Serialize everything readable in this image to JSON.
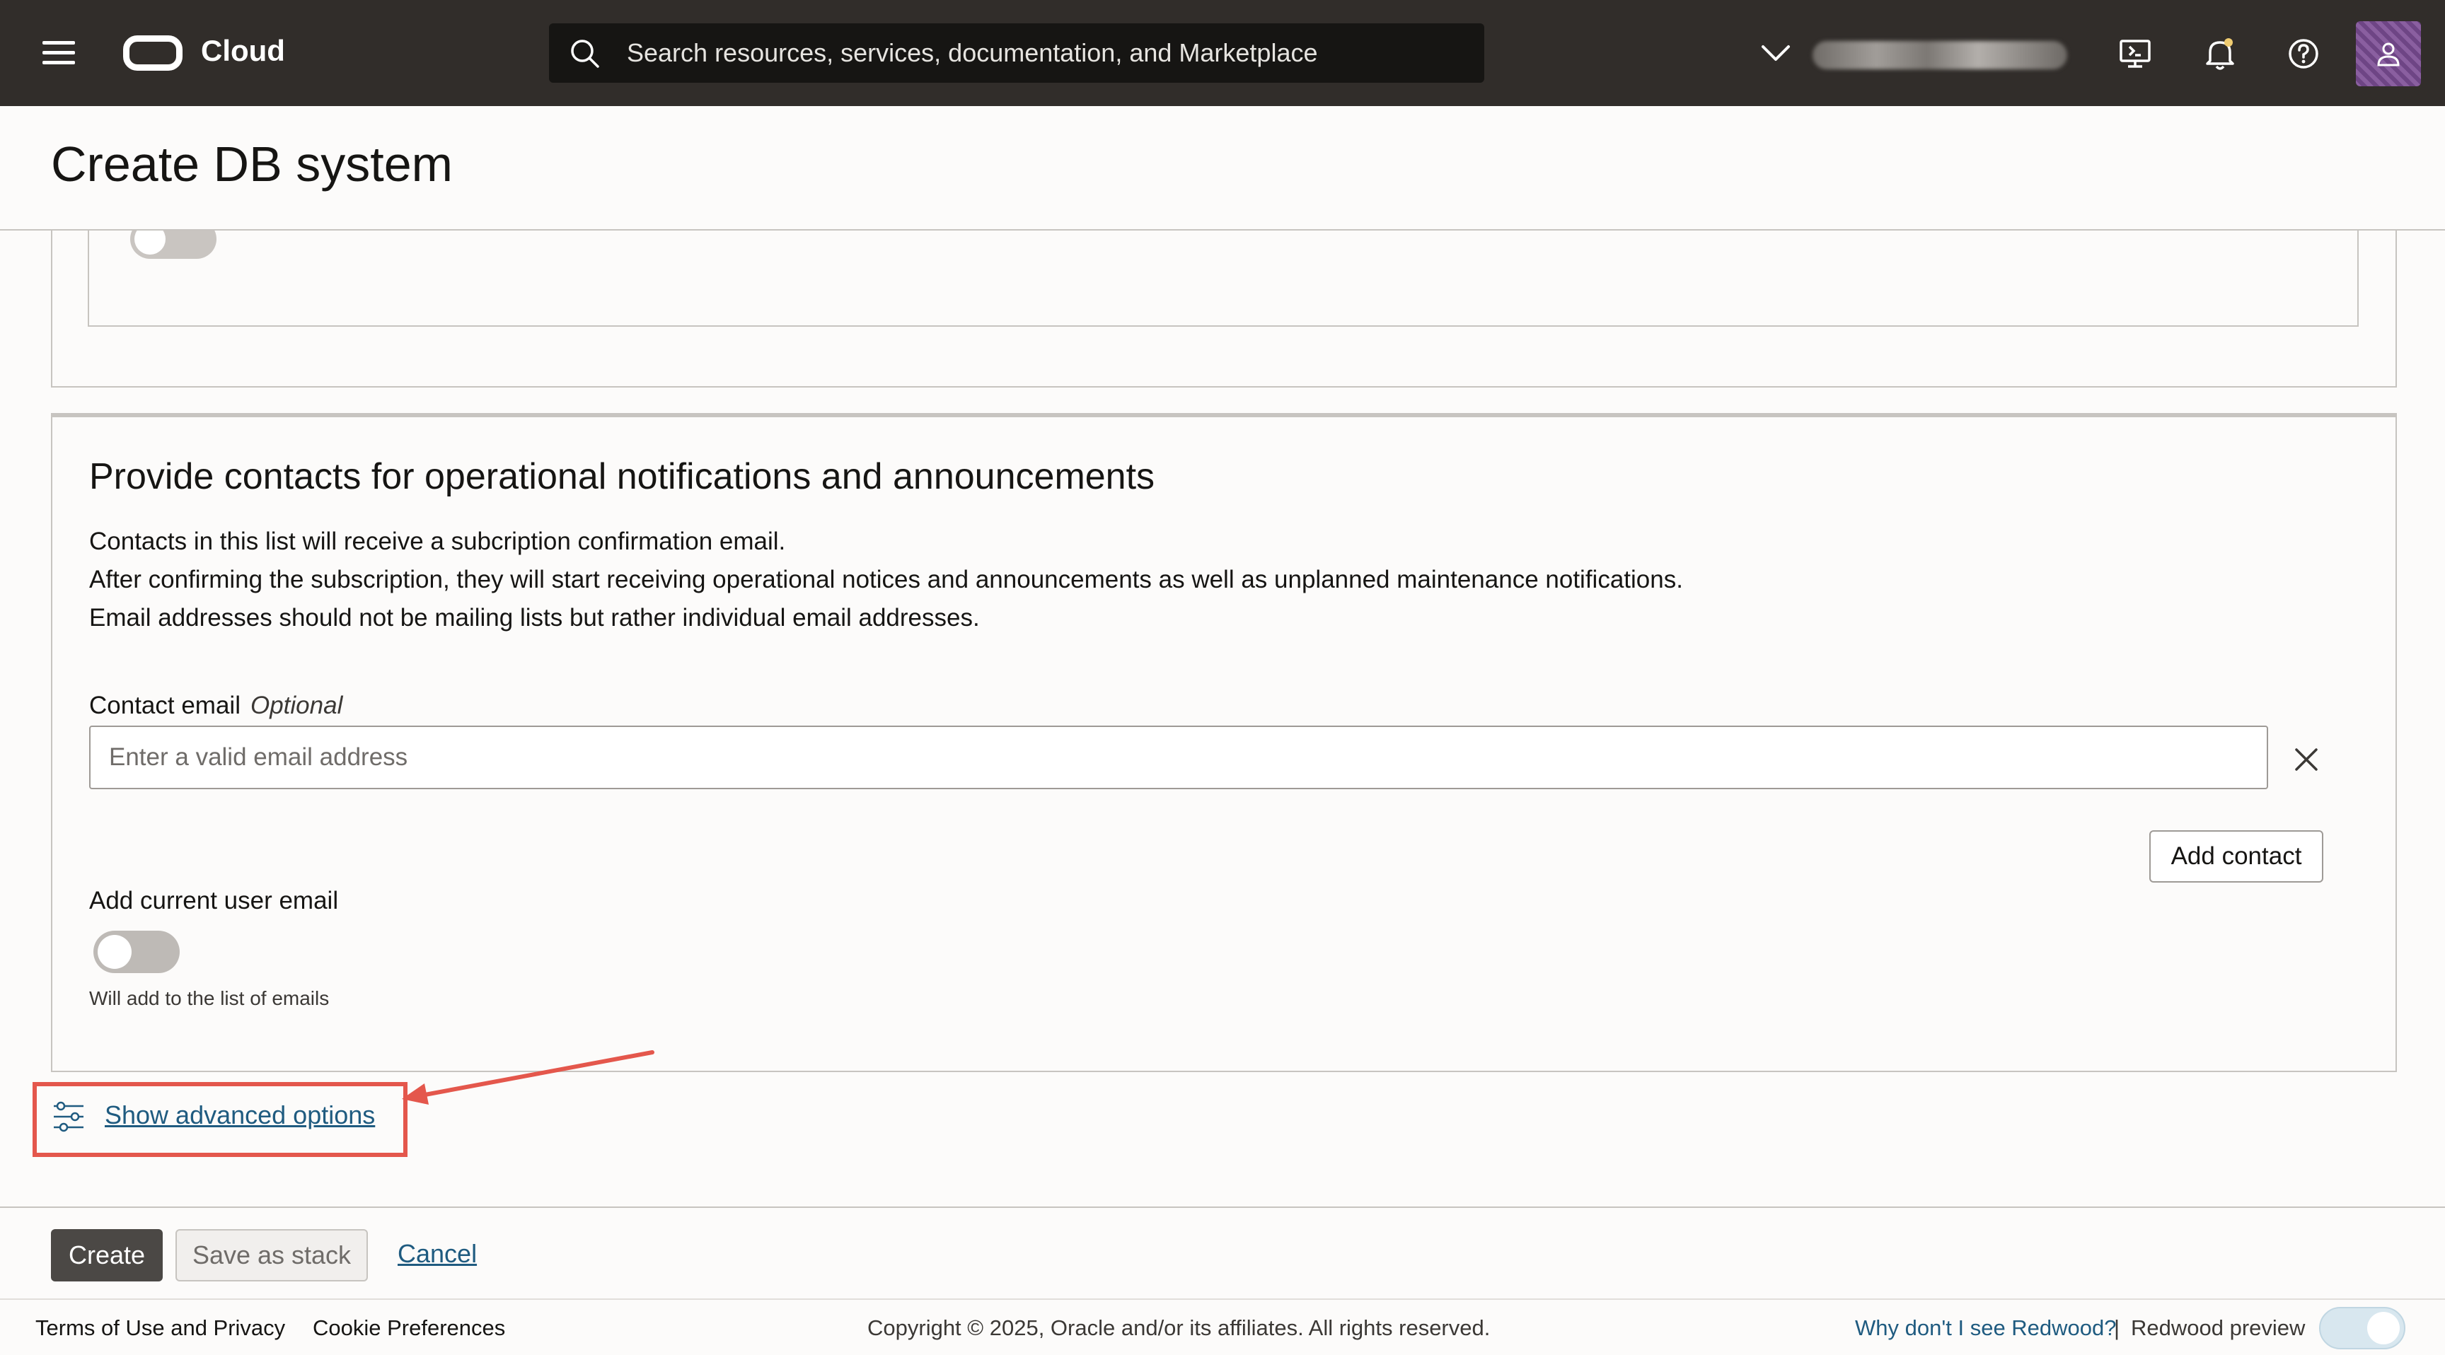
{
  "header": {
    "brand": "Cloud",
    "search_placeholder": "Search resources, services, documentation, and Marketplace",
    "region": "",
    "icons": [
      "menu-icon",
      "oracle-logo",
      "search-icon",
      "chevron-down-icon",
      "cloud-shell-icon",
      "bell-icon",
      "help-icon",
      "profile-icon"
    ]
  },
  "page": {
    "title": "Create DB system"
  },
  "contacts_section": {
    "title": "Provide contacts for operational notifications and announcements",
    "description": [
      "Contacts in this list will receive a subcription confirmation email.",
      "After confirming the subscription, they will start receiving operational notices and announcements as well as unplanned maintenance notifications.",
      "Email addresses should not be mailing lists but rather individual email addresses."
    ],
    "email_label": "Contact email",
    "email_optional": "Optional",
    "email_placeholder": "Enter a valid email address",
    "email_value": "",
    "add_contact_label": "Add contact",
    "current_user_label": "Add current user email",
    "current_user_enabled": false,
    "current_user_helper": "Will add to the list of emails"
  },
  "advanced": {
    "link_label": "Show advanced options"
  },
  "actions": {
    "create_label": "Create",
    "save_stack_label": "Save as stack",
    "cancel_label": "Cancel"
  },
  "footer": {
    "terms": "Terms of Use and Privacy",
    "cookies": "Cookie Preferences",
    "copyright": "Copyright © 2025, Oracle and/or its affiliates. All rights reserved.",
    "why_redwood": "Why don't I see Redwood?",
    "separator": "|",
    "redwood_preview": "Redwood preview",
    "redwood_preview_enabled": true
  },
  "colors": {
    "topbar": "#312d2a",
    "link": "#1f5b80",
    "highlight": "#e4574c",
    "primary_button": "#4b4845"
  }
}
